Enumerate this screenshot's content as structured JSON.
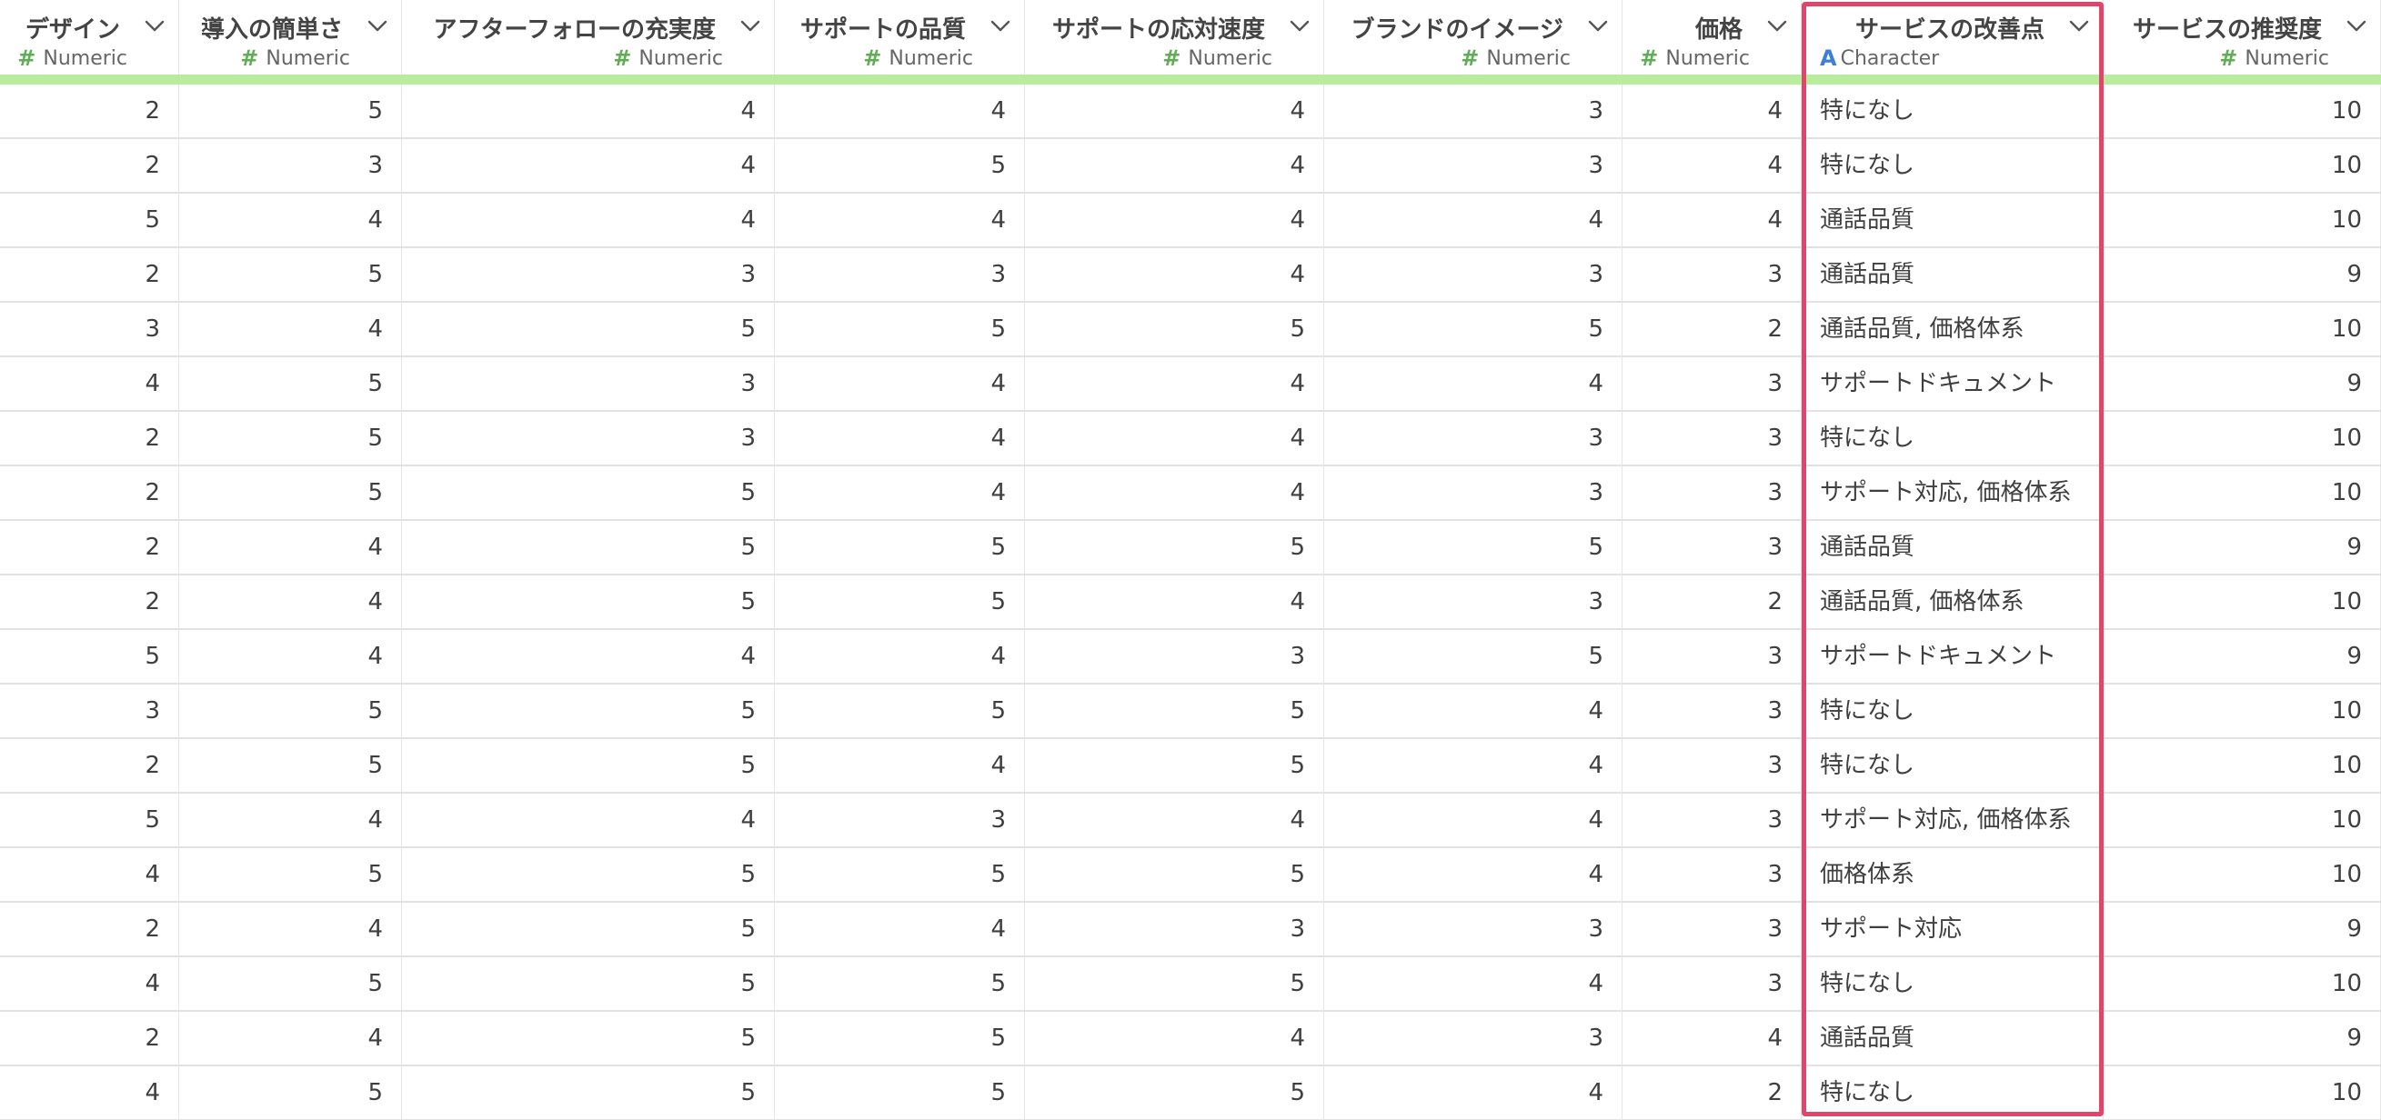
{
  "columns": [
    {
      "name": "デザイン",
      "type": "Numeric",
      "kind": "numeric"
    },
    {
      "name": "導入の簡単さ",
      "type": "Numeric",
      "kind": "numeric"
    },
    {
      "name": "アフターフォローの充実度",
      "type": "Numeric",
      "kind": "numeric"
    },
    {
      "name": "サポートの品質",
      "type": "Numeric",
      "kind": "numeric"
    },
    {
      "name": "サポートの応対速度",
      "type": "Numeric",
      "kind": "numeric"
    },
    {
      "name": "ブランドのイメージ",
      "type": "Numeric",
      "kind": "numeric"
    },
    {
      "name": "価格",
      "type": "Numeric",
      "kind": "numeric"
    },
    {
      "name": "サービスの改善点",
      "type": "Character",
      "kind": "character"
    },
    {
      "name": "サービスの推奨度",
      "type": "Numeric",
      "kind": "numeric"
    }
  ],
  "rows": [
    [
      "2",
      "5",
      "4",
      "4",
      "4",
      "3",
      "4",
      "特になし",
      "10"
    ],
    [
      "2",
      "3",
      "4",
      "5",
      "4",
      "3",
      "4",
      "特になし",
      "10"
    ],
    [
      "5",
      "4",
      "4",
      "4",
      "4",
      "4",
      "4",
      "通話品質",
      "10"
    ],
    [
      "2",
      "5",
      "3",
      "3",
      "4",
      "3",
      "3",
      "通話品質",
      "9"
    ],
    [
      "3",
      "4",
      "5",
      "5",
      "5",
      "5",
      "2",
      "通話品質, 価格体系",
      "10"
    ],
    [
      "4",
      "5",
      "3",
      "4",
      "4",
      "4",
      "3",
      "サポートドキュメント",
      "9"
    ],
    [
      "2",
      "5",
      "3",
      "4",
      "4",
      "3",
      "3",
      "特になし",
      "10"
    ],
    [
      "2",
      "5",
      "5",
      "4",
      "4",
      "3",
      "3",
      "サポート対応, 価格体系",
      "10"
    ],
    [
      "2",
      "4",
      "5",
      "5",
      "5",
      "5",
      "3",
      "通話品質",
      "9"
    ],
    [
      "2",
      "4",
      "5",
      "5",
      "4",
      "3",
      "2",
      "通話品質, 価格体系",
      "10"
    ],
    [
      "5",
      "4",
      "4",
      "4",
      "3",
      "5",
      "3",
      "サポートドキュメント",
      "9"
    ],
    [
      "3",
      "5",
      "5",
      "5",
      "5",
      "4",
      "3",
      "特になし",
      "10"
    ],
    [
      "2",
      "5",
      "5",
      "4",
      "5",
      "4",
      "3",
      "特になし",
      "10"
    ],
    [
      "5",
      "4",
      "4",
      "3",
      "4",
      "4",
      "3",
      "サポート対応, 価格体系",
      "10"
    ],
    [
      "4",
      "5",
      "5",
      "5",
      "5",
      "4",
      "3",
      "価格体系",
      "10"
    ],
    [
      "2",
      "4",
      "5",
      "4",
      "3",
      "3",
      "3",
      "サポート対応",
      "9"
    ],
    [
      "4",
      "5",
      "5",
      "5",
      "5",
      "4",
      "3",
      "特になし",
      "10"
    ],
    [
      "2",
      "4",
      "5",
      "5",
      "4",
      "3",
      "4",
      "通話品質",
      "9"
    ],
    [
      "4",
      "5",
      "5",
      "5",
      "5",
      "4",
      "2",
      "特になし",
      "10"
    ]
  ],
  "colors": {
    "highlight": "#e2456b",
    "filter_bar": "#b9ed9e",
    "numeric_icon": "#5fae55",
    "character_icon": "#3d7fd6"
  },
  "icons": {
    "numeric": "hash-icon",
    "character": "letter-a-icon",
    "menu": "chevron-down-icon"
  }
}
